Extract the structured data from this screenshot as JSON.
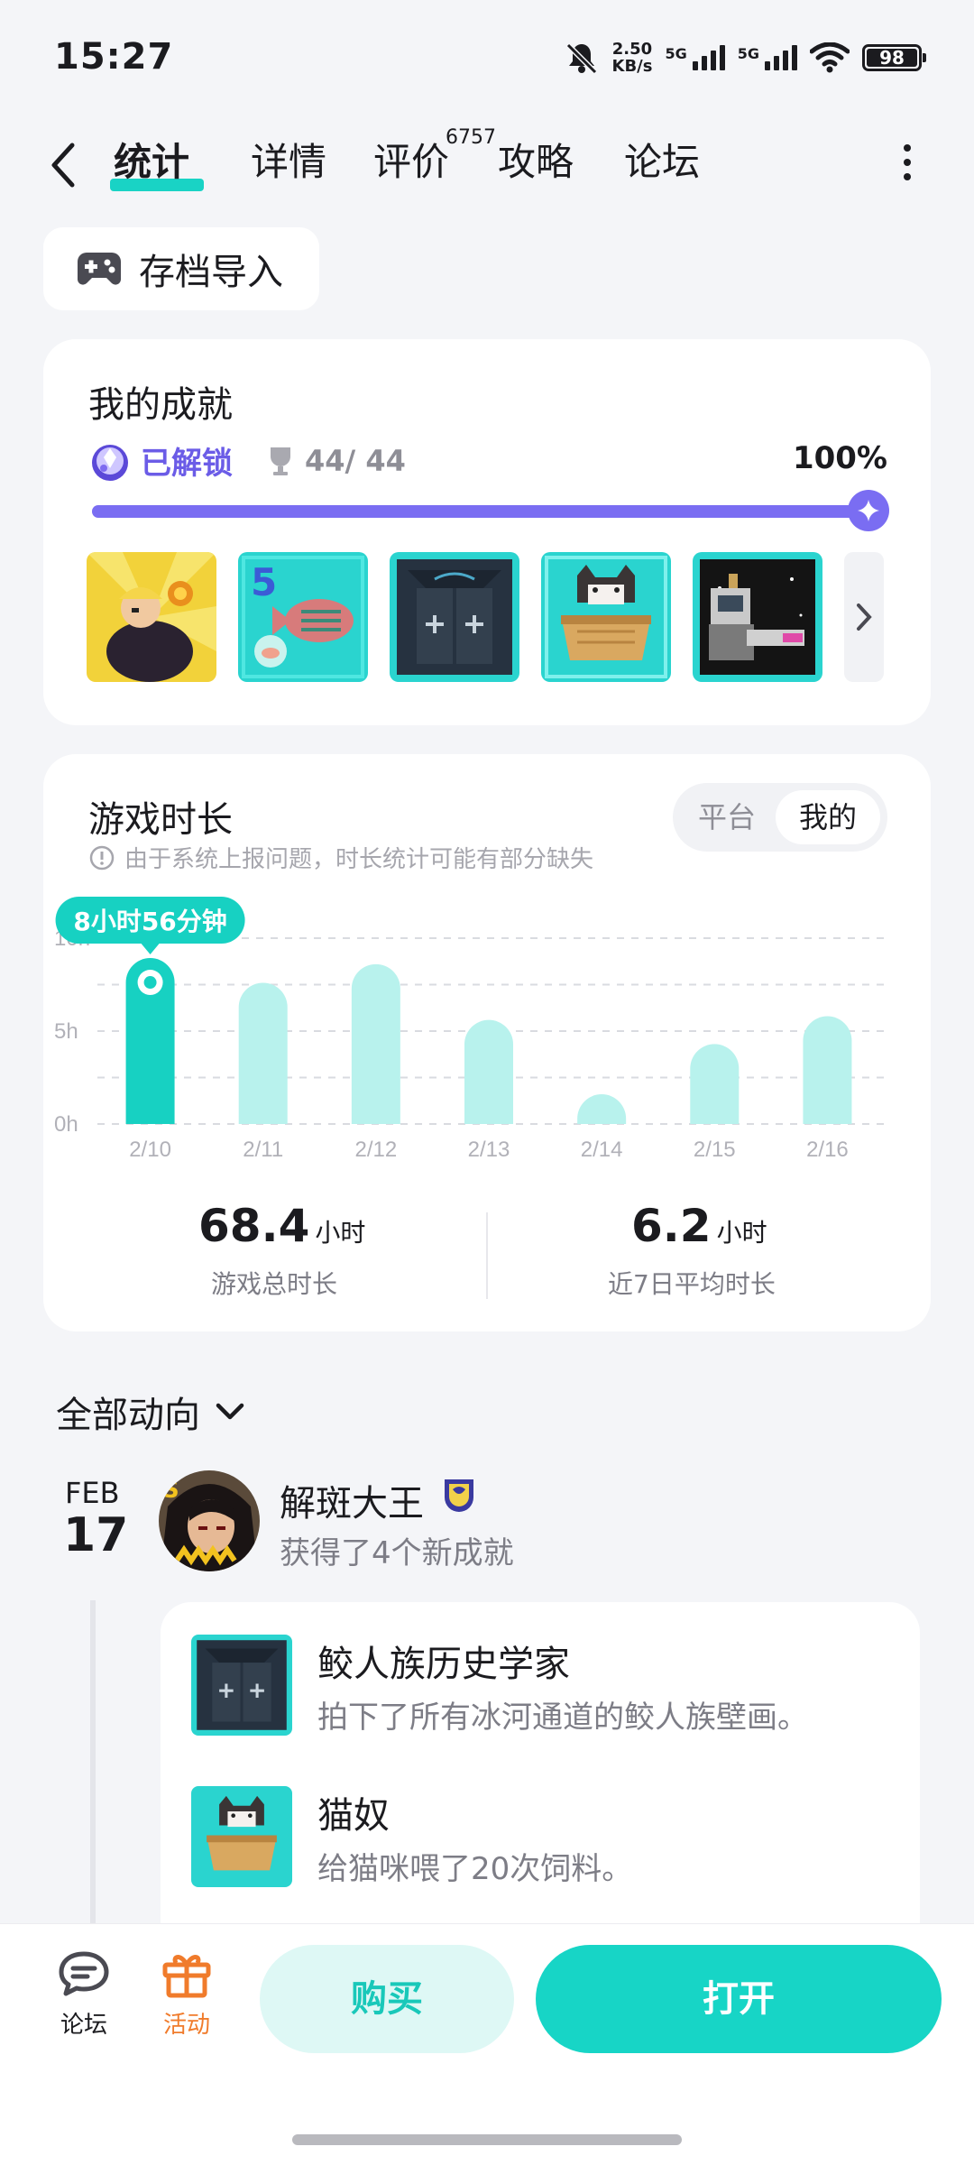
{
  "status_bar": {
    "time": "15:27",
    "net_speed_value": "2.50",
    "net_speed_unit": "KB/s",
    "signal1_label": "5G",
    "signal2_label": "5G",
    "battery": "98"
  },
  "nav": {
    "tabs": [
      {
        "label": "统计",
        "active": true
      },
      {
        "label": "详情"
      },
      {
        "label": "评价"
      },
      {
        "label": "攻略"
      },
      {
        "label": "论坛"
      }
    ],
    "review_count": "6757"
  },
  "import_button": {
    "label": "存档导入"
  },
  "achievements": {
    "title": "我的成就",
    "unlocked_label": "已解锁",
    "trophy_count": "44/ 44",
    "percent": "100%",
    "progress": 1.0
  },
  "playtime": {
    "title": "游戏时长",
    "note": "由于系统上报问题，时长统计可能有部分缺失",
    "toggle": {
      "platform": "平台",
      "mine": "我的",
      "selected": "mine"
    },
    "tooltip": "8小时56分钟",
    "total_value": "68.4",
    "total_unit": "小时",
    "total_label": "游戏总时长",
    "avg_value": "6.2",
    "avg_unit": "小时",
    "avg_label": "近7日平均时长"
  },
  "chart_data": {
    "type": "bar",
    "categories": [
      "2/10",
      "2/11",
      "2/12",
      "2/13",
      "2/14",
      "2/15",
      "2/16"
    ],
    "values": [
      8.93,
      7.6,
      8.6,
      5.6,
      1.6,
      4.3,
      5.8
    ],
    "yticks": [
      "0h",
      "5h",
      "10h"
    ],
    "ylim": [
      0,
      10
    ],
    "highlight_index": 0,
    "colors": {
      "highlight": "#17d1c2",
      "bar": "#b8f2ed",
      "grid": "#d9dbe0"
    }
  },
  "feed": {
    "filter_label": "全部动向",
    "date_month": "FEB",
    "date_day": "17",
    "user_name": "解斑大王",
    "action": "获得了4个新成就",
    "items": [
      {
        "name": "鲛人族历史学家",
        "desc": "拍下了所有冰河通道的鲛人族壁画。"
      },
      {
        "name": "猫奴",
        "desc": "给猫咪喂了20次饲料。"
      }
    ]
  },
  "bottom_bar": {
    "forum_label": "论坛",
    "event_label": "活动",
    "buy_label": "购买",
    "open_label": "打开"
  }
}
